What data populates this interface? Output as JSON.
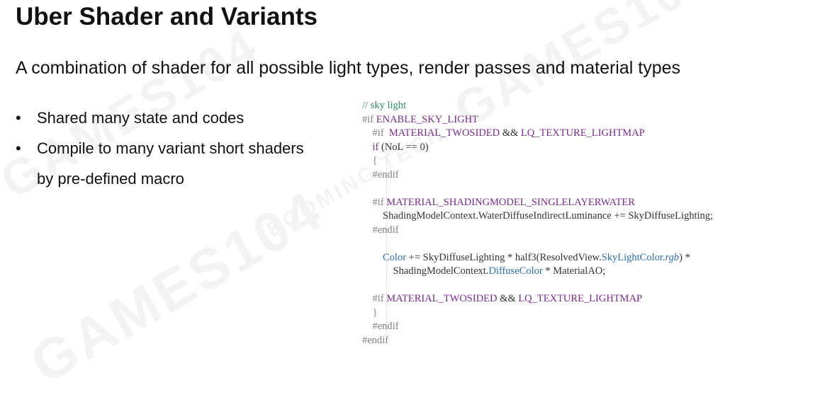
{
  "slide": {
    "title": "Uber Shader and Variants",
    "subtitle": "A combination of shader for all possible light types, render passes and material types",
    "bullets": [
      {
        "marker": "•",
        "text": "Shared many state and codes"
      },
      {
        "marker": "•",
        "text": "Compile to many variant short shaders",
        "continuation": "by pre-defined macro"
      }
    ]
  },
  "watermarks": [
    "GAMES104",
    "BOOMING TECH"
  ],
  "code": {
    "comment": "// sky light",
    "pp_if": "#if",
    "pp_endif": "#endif",
    "enable_sky_light": "ENABLE_SKY_LIGHT",
    "material_twosided": "MATERIAL_TWOSIDED",
    "and_op": "&&",
    "lq_texture_lightmap": "LQ_TEXTURE_LIGHTMAP",
    "if_kw": "if",
    "nol_cond": "(NoL == 0)",
    "open_brace": "{",
    "close_brace": "}",
    "shadingmodel_singlelayerwater": "MATERIAL_SHADINGMODEL_SINGLELAYERWATER",
    "water_line": "ShadingModelContext.WaterDiffuseIndirectLuminance += SkyDiffuseLighting;",
    "color_kw": "Color",
    "color_expr_a": "+= SkyDiffuseLighting * half3(ResolvedView.",
    "skylightcolor": "SkyLightColor.",
    "rgb": "rgb",
    "color_expr_b": ") *",
    "smc_prefix": "ShadingModelContext.",
    "diffusecolor": "DiffuseColor",
    "material_ao": "* MaterialAO;"
  }
}
